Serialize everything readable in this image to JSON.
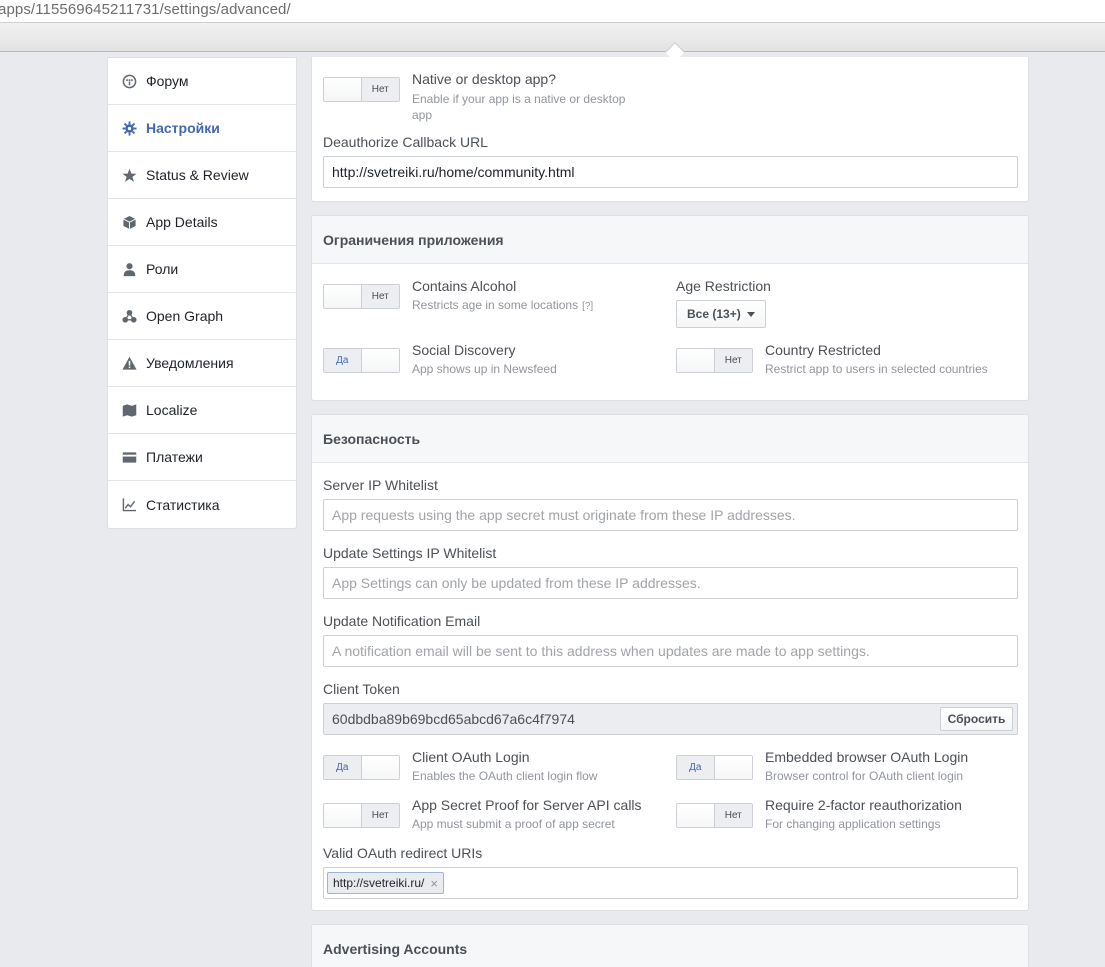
{
  "browser": {
    "url": "apps/115569645211731/settings/advanced/"
  },
  "sidebar": {
    "items": [
      {
        "label": "Форум",
        "icon": "forum-icon"
      },
      {
        "label": "Настройки",
        "icon": "gear-icon",
        "active": true
      },
      {
        "label": "Status & Review",
        "icon": "star-icon"
      },
      {
        "label": "App Details",
        "icon": "cube-icon"
      },
      {
        "label": "Роли",
        "icon": "person-icon"
      },
      {
        "label": "Open Graph",
        "icon": "graph-icon"
      },
      {
        "label": "Уведомления",
        "icon": "warning-icon"
      },
      {
        "label": "Localize",
        "icon": "map-icon"
      },
      {
        "label": "Платежи",
        "icon": "card-icon"
      },
      {
        "label": "Статистика",
        "icon": "chart-icon"
      }
    ]
  },
  "top_panel": {
    "native_app": {
      "title": "Native or desktop app?",
      "desc": "Enable if your app is a native or desktop app",
      "toggle": "Нет"
    },
    "deauth_label": "Deauthorize Callback URL",
    "deauth_value": "http://svetreiki.ru/home/community.html"
  },
  "restrictions": {
    "title": "Ограничения приложения",
    "alcohol": {
      "title": "Contains Alcohol",
      "desc": "Restricts age in some locations",
      "help": "[?]",
      "toggle": "Нет"
    },
    "age": {
      "title": "Age Restriction",
      "value": "Все (13+)"
    },
    "social": {
      "title": "Social Discovery",
      "desc": "App shows up in Newsfeed",
      "toggle": "Да"
    },
    "country": {
      "title": "Country Restricted",
      "desc": "Restrict app to users in selected countries",
      "toggle": "Нет"
    }
  },
  "security": {
    "title": "Безопасность",
    "server_ip_label": "Server IP Whitelist",
    "server_ip_placeholder": "App requests using the app secret must originate from these IP addresses.",
    "update_ip_label": "Update Settings IP Whitelist",
    "update_ip_placeholder": "App Settings can only be updated from these IP addresses.",
    "notify_label": "Update Notification Email",
    "notify_placeholder": "A notification email will be sent to this address when updates are made to app settings.",
    "token_label": "Client Token",
    "token_value": "60dbdba89b69bcd65abcd67a6c4f7974",
    "reset_label": "Сбросить",
    "client_oauth": {
      "title": "Client OAuth Login",
      "desc": "Enables the OAuth client login flow",
      "toggle": "Да"
    },
    "embedded_oauth": {
      "title": "Embedded browser OAuth Login",
      "desc": "Browser control for OAuth client login",
      "toggle": "Да"
    },
    "secret_proof": {
      "title": "App Secret Proof for Server API calls",
      "desc": "App must submit a proof of app secret",
      "toggle": "Нет"
    },
    "twofactor": {
      "title": "Require 2-factor reauthorization",
      "desc": "For changing application settings",
      "toggle": "Нет"
    },
    "redirect_label": "Valid OAuth redirect URIs",
    "redirect_token": "http://svetreiki.ru/",
    "redirect_remove": "×"
  },
  "advertising": {
    "title": "Advertising Accounts"
  },
  "colors": {
    "accent": "#4267b2",
    "background": "#e9eaed",
    "border": "#dddfe2"
  }
}
